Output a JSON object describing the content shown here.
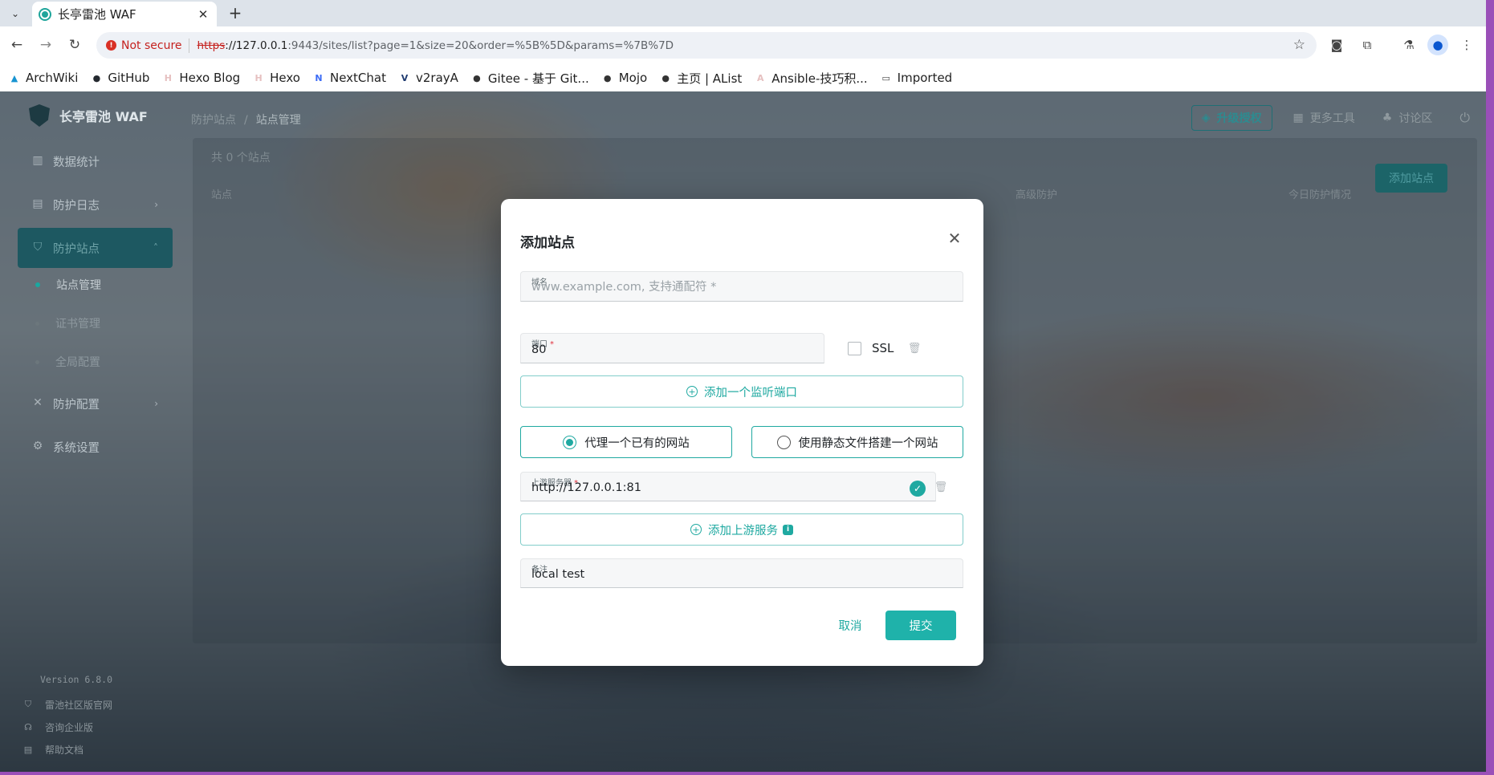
{
  "browser": {
    "tab_title": "长亭雷池 WAF",
    "tab_close": "✕",
    "new_tab": "+",
    "security_label": "Not secure",
    "url_scheme": "https",
    "url_host": "://127.0.0.1",
    "url_rest": ":9443/sites/list?page=1&size=20&order=%5B%5D&params=%7B%7D",
    "bookmarks": [
      {
        "label": "ArchWiki",
        "icon": "archlinux-icon",
        "color": "#1793d1"
      },
      {
        "label": "GitHub",
        "icon": "github-icon",
        "color": "#24292f"
      },
      {
        "label": "Hexo Blog",
        "icon": "hexo-icon",
        "color": "#e6c0c0"
      },
      {
        "label": "Hexo",
        "icon": "hexo-icon",
        "color": "#e6c0c0"
      },
      {
        "label": "NextChat",
        "icon": "nextchat-icon",
        "color": "#3b6bf5"
      },
      {
        "label": "v2rayA",
        "icon": "v2raya-icon",
        "color": "#1f3b70"
      },
      {
        "label": "Gitee - 基于 Git...",
        "icon": "gitee-icon",
        "color": "#333333"
      },
      {
        "label": "Mojo",
        "icon": "mojo-icon",
        "color": "#333333"
      },
      {
        "label": "主页 | AList",
        "icon": "alist-icon",
        "color": "#333333"
      },
      {
        "label": "Ansible-技巧积...",
        "icon": "ansible-icon",
        "color": "#e6c0c0"
      },
      {
        "label": "Imported",
        "icon": "folder-icon",
        "color": "#444444"
      }
    ]
  },
  "app": {
    "brand": "长亭雷池 WAF",
    "breadcrumb": {
      "parent": "防护站点",
      "sep": "/",
      "current": "站点管理"
    },
    "top_actions": {
      "upgrade": "升级授权",
      "more_tools": "更多工具",
      "forum": "讨论区"
    },
    "sidebar": {
      "items": [
        {
          "label": "数据统计",
          "icon": "bar-chart-icon"
        },
        {
          "label": "防护日志",
          "icon": "log-icon"
        },
        {
          "label": "防护站点",
          "icon": "shield-icon"
        },
        {
          "label": "防护配置",
          "icon": "tools-icon"
        },
        {
          "label": "系统设置",
          "icon": "gear-icon"
        }
      ],
      "sub_items": [
        "站点管理",
        "证书管理",
        "全局配置"
      ],
      "version": "Version 6.8.0",
      "footer_links": [
        "雷池社区版官网",
        "咨询企业版",
        "帮助文档"
      ]
    },
    "content": {
      "site_count": "共 0 个站点",
      "add_site": "添加站点",
      "columns": [
        "站点",
        "高级防护",
        "今日防护情况"
      ]
    }
  },
  "modal": {
    "title": "添加站点",
    "domain": {
      "label": "域名",
      "placeholder": "www.example.com, 支持通配符 *",
      "value": ""
    },
    "port": {
      "label": "端口",
      "required": "*",
      "value": "80"
    },
    "ssl_label": "SSL",
    "add_port": "添加一个监听端口",
    "mode_options": [
      {
        "label": "代理一个已有的网站",
        "selected": true
      },
      {
        "label": "使用静态文件搭建一个网站",
        "selected": false
      }
    ],
    "upstream": {
      "label": "上游服务器",
      "required": "*",
      "value": "http://127.0.0.1:81"
    },
    "add_upstream": "添加上游服务",
    "remark": {
      "label": "备注",
      "value": "local test"
    },
    "cancel": "取消",
    "submit": "提交",
    "accent_color": "#1fb2aa"
  }
}
